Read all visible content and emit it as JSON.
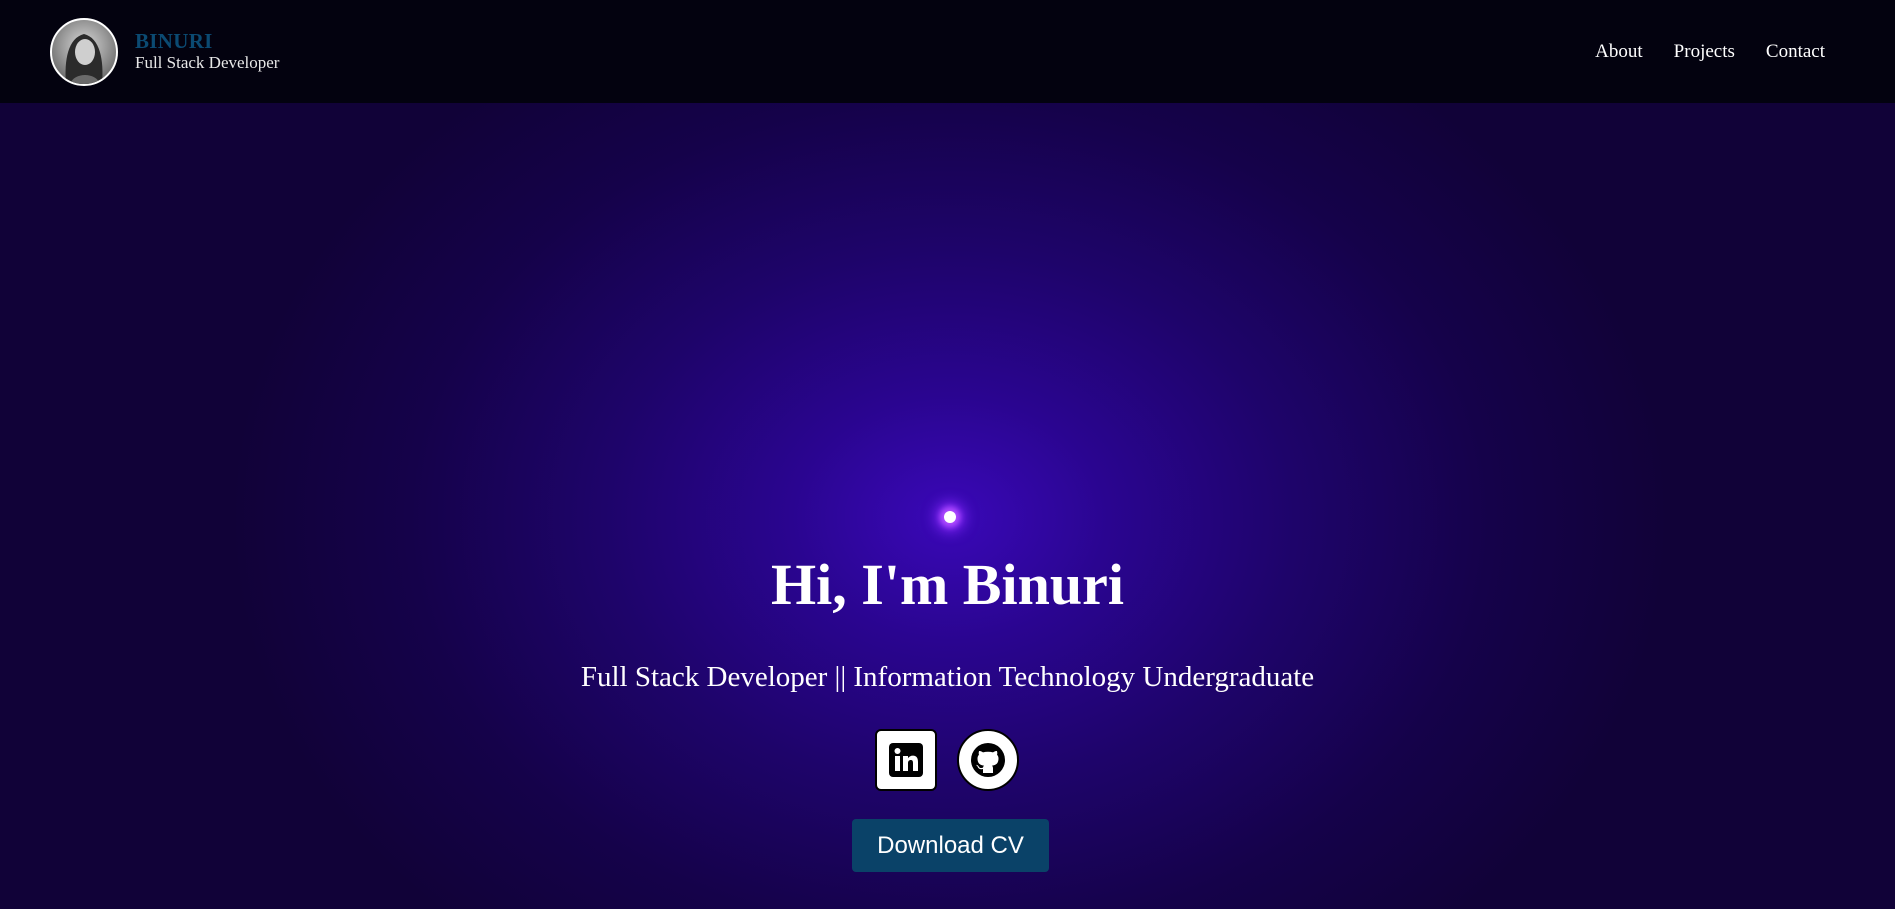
{
  "navbar": {
    "brand_name": "BINURI",
    "brand_role": "Full Stack Developer",
    "avatar_icon": "profile-photo",
    "links": [
      {
        "label": "About"
      },
      {
        "label": "Projects"
      },
      {
        "label": "Contact"
      }
    ]
  },
  "hero": {
    "title": "Hi, I'm Binuri",
    "subtitle": "Full Stack Developer || Information Technology Undergraduate",
    "socials": [
      {
        "icon": "linkedin-icon"
      },
      {
        "icon": "github-icon"
      }
    ],
    "download_label": "Download CV"
  },
  "colors": {
    "navbar_bg": "#03020f",
    "brand_accent": "#0b4a72",
    "hero_bg": "#1e046a",
    "hero_glow": "#3a08b8",
    "button_bg": "#0a4268"
  }
}
